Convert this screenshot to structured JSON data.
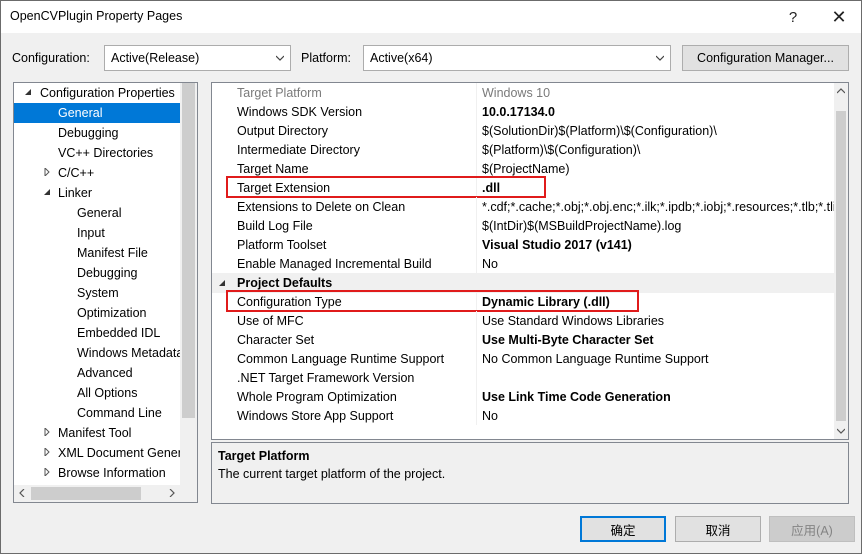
{
  "window": {
    "title": "OpenCVPlugin Property Pages",
    "help_label": "?",
    "close_label": "✕"
  },
  "toolbar": {
    "configuration_label": "Configuration:",
    "configuration_value": "Active(Release)",
    "platform_label": "Platform:",
    "platform_value": "Active(x64)",
    "config_manager_label": "Configuration Manager..."
  },
  "tree": {
    "items": [
      {
        "label": "Configuration Properties",
        "level": 0,
        "toggle": "expanded"
      },
      {
        "label": "General",
        "level": 1,
        "toggle": "none",
        "selected": true
      },
      {
        "label": "Debugging",
        "level": 1,
        "toggle": "none"
      },
      {
        "label": "VC++ Directories",
        "level": 1,
        "toggle": "none"
      },
      {
        "label": "C/C++",
        "level": 1,
        "toggle": "collapsed"
      },
      {
        "label": "Linker",
        "level": 1,
        "toggle": "expanded"
      },
      {
        "label": "General",
        "level": 2,
        "toggle": "none"
      },
      {
        "label": "Input",
        "level": 2,
        "toggle": "none"
      },
      {
        "label": "Manifest File",
        "level": 2,
        "toggle": "none"
      },
      {
        "label": "Debugging",
        "level": 2,
        "toggle": "none"
      },
      {
        "label": "System",
        "level": 2,
        "toggle": "none"
      },
      {
        "label": "Optimization",
        "level": 2,
        "toggle": "none"
      },
      {
        "label": "Embedded IDL",
        "level": 2,
        "toggle": "none"
      },
      {
        "label": "Windows Metadata",
        "level": 2,
        "toggle": "none"
      },
      {
        "label": "Advanced",
        "level": 2,
        "toggle": "none"
      },
      {
        "label": "All Options",
        "level": 2,
        "toggle": "none"
      },
      {
        "label": "Command Line",
        "level": 2,
        "toggle": "none"
      },
      {
        "label": "Manifest Tool",
        "level": 1,
        "toggle": "collapsed"
      },
      {
        "label": "XML Document Generator",
        "level": 1,
        "toggle": "collapsed"
      },
      {
        "label": "Browse Information",
        "level": 1,
        "toggle": "collapsed"
      }
    ]
  },
  "grid": {
    "rows": [
      {
        "type": "prop",
        "name": "Target Platform",
        "value": "Windows 10",
        "style": "gray"
      },
      {
        "type": "prop",
        "name": "Windows SDK Version",
        "value": "10.0.17134.0",
        "style": "bold"
      },
      {
        "type": "prop",
        "name": "Output Directory",
        "value": "$(SolutionDir)$(Platform)\\$(Configuration)\\",
        "style": "normal"
      },
      {
        "type": "prop",
        "name": "Intermediate Directory",
        "value": "$(Platform)\\$(Configuration)\\",
        "style": "normal"
      },
      {
        "type": "prop",
        "name": "Target Name",
        "value": "$(ProjectName)",
        "style": "normal"
      },
      {
        "type": "prop",
        "name": "Target Extension",
        "value": ".dll",
        "style": "bold",
        "highlight": true
      },
      {
        "type": "prop",
        "name": "Extensions to Delete on Clean",
        "value": "*.cdf;*.cache;*.obj;*.obj.enc;*.ilk;*.ipdb;*.iobj;*.resources;*.tlb;*.tli;*.tlh;*.tmp",
        "style": "normal"
      },
      {
        "type": "prop",
        "name": "Build Log File",
        "value": "$(IntDir)$(MSBuildProjectName).log",
        "style": "normal"
      },
      {
        "type": "prop",
        "name": "Platform Toolset",
        "value": "Visual Studio 2017 (v141)",
        "style": "bold"
      },
      {
        "type": "prop",
        "name": "Enable Managed Incremental Build",
        "value": "No",
        "style": "normal"
      },
      {
        "type": "category",
        "name": "Project Defaults"
      },
      {
        "type": "prop",
        "name": "Configuration Type",
        "value": "Dynamic Library (.dll)",
        "style": "bold",
        "highlight": true
      },
      {
        "type": "prop",
        "name": "Use of MFC",
        "value": "Use Standard Windows Libraries",
        "style": "normal"
      },
      {
        "type": "prop",
        "name": "Character Set",
        "value": "Use Multi-Byte Character Set",
        "style": "bold"
      },
      {
        "type": "prop",
        "name": "Common Language Runtime Support",
        "value": "No Common Language Runtime Support",
        "style": "normal"
      },
      {
        "type": "prop",
        "name": ".NET Target Framework Version",
        "value": "",
        "style": "normal"
      },
      {
        "type": "prop",
        "name": "Whole Program Optimization",
        "value": "Use Link Time Code Generation",
        "style": "bold"
      },
      {
        "type": "prop",
        "name": "Windows Store App Support",
        "value": "No",
        "style": "normal"
      }
    ]
  },
  "description": {
    "title": "Target Platform",
    "text": "The current target platform of the project."
  },
  "buttons": {
    "ok": "确定",
    "cancel": "取消",
    "apply": "应用(A)"
  },
  "colors": {
    "selection": "#0078d7",
    "highlight_box": "#e01b1b"
  }
}
